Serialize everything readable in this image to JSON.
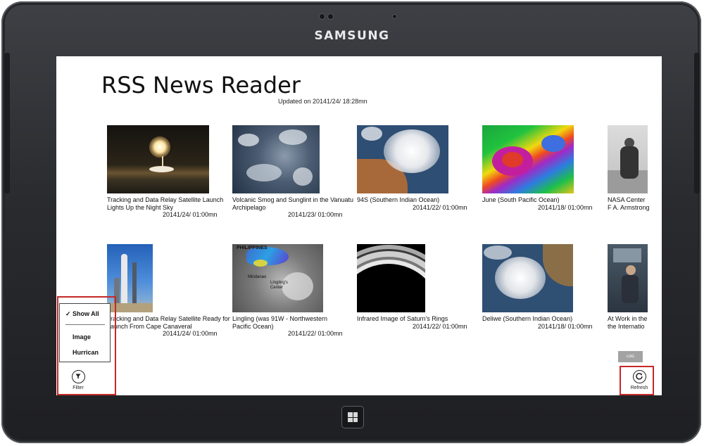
{
  "device": {
    "brand": "SAMSUNG"
  },
  "app": {
    "title": "RSS News Reader",
    "updated": "Updated on 20141/24/ 18:28mn"
  },
  "items_row1": [
    {
      "title": "Tracking and Data Relay Satellite Launch Lights Up the Night Sky",
      "date": "20141/24/ 01:00mn"
    },
    {
      "title": "Volcanic Smog and Sunglint in the Vanuatu Archipelago",
      "date": "20141/23/ 01:00mn"
    },
    {
      "title": "94S (Southern Indian Ocean)",
      "date": "20141/22/ 01:00mn"
    },
    {
      "title": "June (South Pacific Ocean)",
      "date": "20141/18/ 01:00mn"
    },
    {
      "title": "NASA Center F A. Armstrong"
    }
  ],
  "items_row2": [
    {
      "title": "Tracking and Data Relay Satellite Ready for Launch From Cape Canaveral",
      "date": "20141/24/ 01:00mn"
    },
    {
      "title": "Lingling (was 91W - Northwestern Pacific Ocean)",
      "date": "20141/22/ 01:00mn"
    },
    {
      "title": "Infrared Image of Saturn's Rings",
      "date": "20141/22/ 01:00mn"
    },
    {
      "title": "Deliwe (Southern Indian Ocean)",
      "date": "20141/18/ 01:00mn"
    },
    {
      "title": "At Work in the the Internatio"
    }
  ],
  "map_labels": {
    "philippines": "PHILIPPINES",
    "mindanao": "Mindanao",
    "lingling": "Lingling's Center"
  },
  "filter_menu": {
    "options": [
      "Show All",
      "Image",
      "Hurrican"
    ],
    "selected": "Show All",
    "check": "✓"
  },
  "appbar": {
    "filter_label": "Filter",
    "refresh_label": "Refresh",
    "log_label": "LOG"
  },
  "colors": {
    "bezel": "#2e2f33",
    "highlight": "#c62828",
    "log_button": "#a3a3a3"
  },
  "icons": {
    "filter": "funnel-icon",
    "refresh": "refresh-icon",
    "home": "windows-logo-icon"
  }
}
